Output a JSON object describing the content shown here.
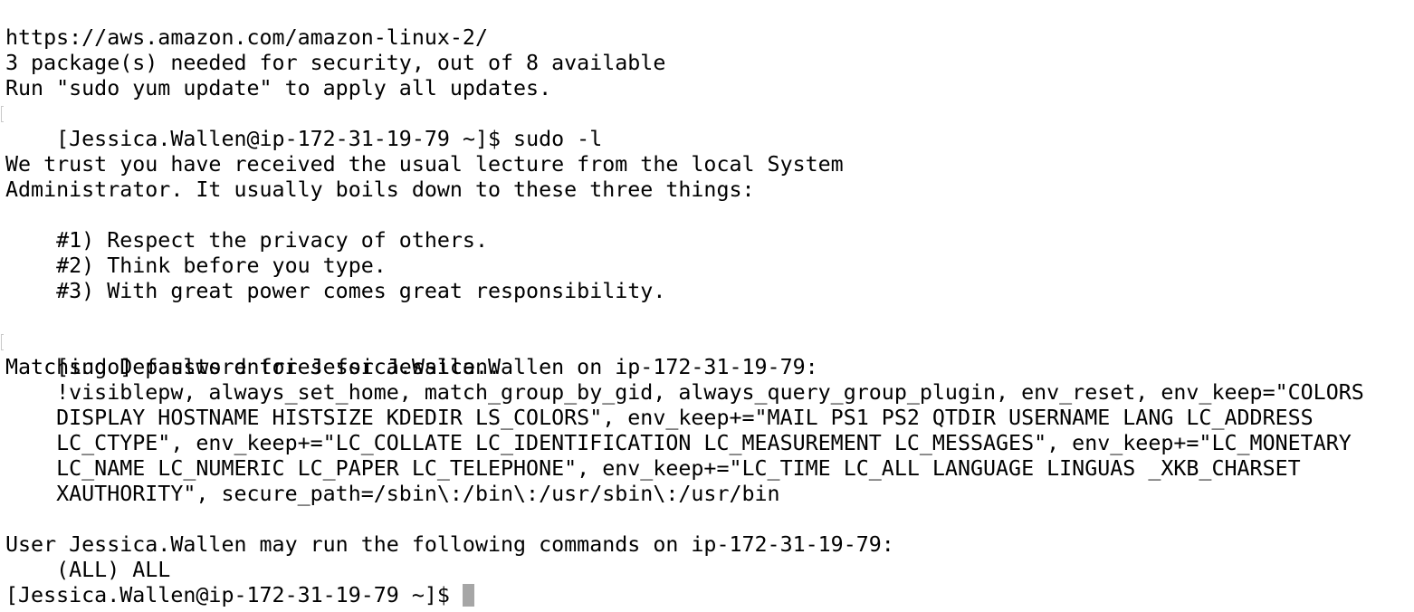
{
  "terminal": {
    "lines": [
      {
        "text": "https://aws.amazon.com/amazon-linux-2/"
      },
      {
        "text": "3 package(s) needed for security, out of 8 available"
      },
      {
        "text": "Run \"sudo yum update\" to apply all updates."
      },
      {
        "text": "[Jessica.Wallen@ip-172-31-19-79 ~]$ sudo -l"
      },
      {
        "text": ""
      },
      {
        "text": "We trust you have received the usual lecture from the local System"
      },
      {
        "text": "Administrator. It usually boils down to these three things:"
      },
      {
        "text": ""
      },
      {
        "text": "    #1) Respect the privacy of others."
      },
      {
        "text": "    #2) Think before you type."
      },
      {
        "text": "    #3) With great power comes great responsibility."
      },
      {
        "text": ""
      },
      {
        "text": "[sudo] password for Jessica.Wallen:"
      },
      {
        "text": "Matching Defaults entries for Jessica.Wallen on ip-172-31-19-79:"
      },
      {
        "text": "    !visiblepw, always_set_home, match_group_by_gid, always_query_group_plugin, env_reset, env_keep=\"COLORS"
      },
      {
        "text": "    DISPLAY HOSTNAME HISTSIZE KDEDIR LS_COLORS\", env_keep+=\"MAIL PS1 PS2 QTDIR USERNAME LANG LC_ADDRESS"
      },
      {
        "text": "    LC_CTYPE\", env_keep+=\"LC_COLLATE LC_IDENTIFICATION LC_MEASUREMENT LC_MESSAGES\", env_keep+=\"LC_MONETARY"
      },
      {
        "text": "    LC_NAME LC_NUMERIC LC_PAPER LC_TELEPHONE\", env_keep+=\"LC_TIME LC_ALL LANGUAGE LINGUAS _XKB_CHARSET"
      },
      {
        "text": "    XAUTHORITY\", secure_path=/sbin\\:/bin\\:/usr/sbin\\:/usr/bin"
      },
      {
        "text": ""
      },
      {
        "text": "User Jessica.Wallen may run the following commands on ip-172-31-19-79:"
      },
      {
        "text": "    (ALL) ALL"
      }
    ],
    "prompt": "[Jessica.Wallen@ip-172-31-19-79 ~]$ ",
    "marked_lines": [
      3,
      12
    ],
    "cursor_color": "#a6a6a6",
    "text_color": "#000000",
    "background_color": "#ffffff"
  }
}
